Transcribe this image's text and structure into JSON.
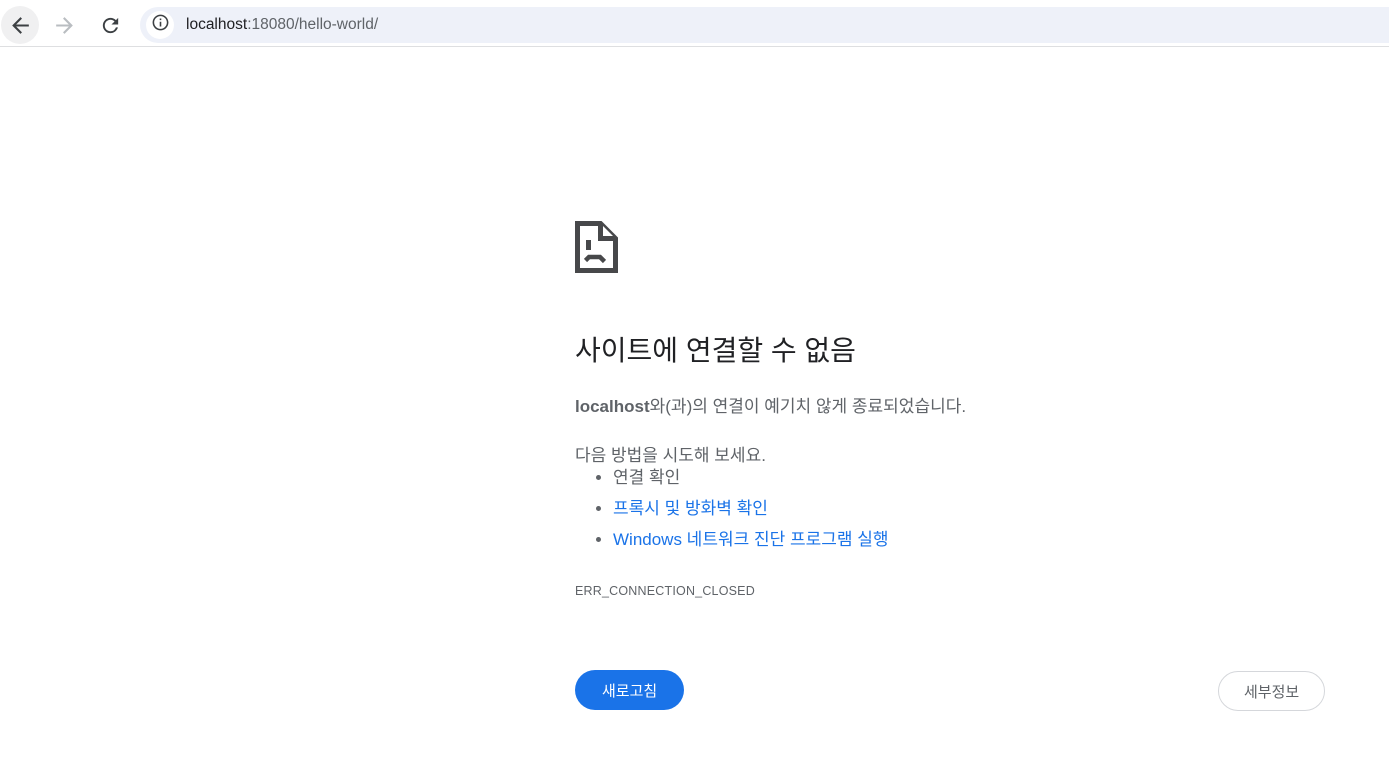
{
  "browser": {
    "url_host": "localhost",
    "url_rest": ":18080/hello-world/",
    "back_icon": "back-arrow",
    "forward_icon": "forward-arrow",
    "reload_icon": "reload",
    "site_info_icon": "info"
  },
  "error_page": {
    "title": "사이트에 연결할 수 없음",
    "message_host": "localhost",
    "message_rest": "와(과)의 연결이 예기치 않게 종료되었습니다.",
    "suggestions_title": "다음 방법을 시도해 보세요.",
    "suggestions": [
      {
        "label": "연결 확인",
        "is_link": false
      },
      {
        "label": "프록시 및 방화벽 확인",
        "is_link": true
      },
      {
        "label": "Windows 네트워크 진단 프로그램 실행",
        "is_link": true
      }
    ],
    "error_code": "ERR_CONNECTION_CLOSED",
    "reload_button": "새로고침",
    "details_button": "세부정보"
  },
  "colors": {
    "accent_blue": "#1a73e8",
    "link_blue": "#1a73e8",
    "title_text": "#202124",
    "body_text": "#5f6368",
    "urlbar_bg": "#eef1f9",
    "toolbar_divider": "#dedfe1",
    "icon_gray": "#47484a"
  }
}
